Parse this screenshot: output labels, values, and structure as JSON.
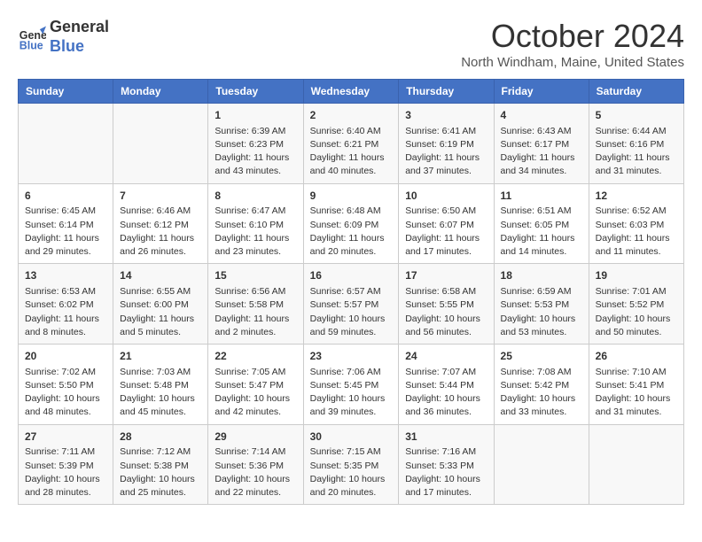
{
  "header": {
    "logo_line1": "General",
    "logo_line2": "Blue",
    "month": "October 2024",
    "location": "North Windham, Maine, United States"
  },
  "days_of_week": [
    "Sunday",
    "Monday",
    "Tuesday",
    "Wednesday",
    "Thursday",
    "Friday",
    "Saturday"
  ],
  "weeks": [
    [
      {
        "day": "",
        "info": ""
      },
      {
        "day": "",
        "info": ""
      },
      {
        "day": "1",
        "info": "Sunrise: 6:39 AM\nSunset: 6:23 PM\nDaylight: 11 hours and 43 minutes."
      },
      {
        "day": "2",
        "info": "Sunrise: 6:40 AM\nSunset: 6:21 PM\nDaylight: 11 hours and 40 minutes."
      },
      {
        "day": "3",
        "info": "Sunrise: 6:41 AM\nSunset: 6:19 PM\nDaylight: 11 hours and 37 minutes."
      },
      {
        "day": "4",
        "info": "Sunrise: 6:43 AM\nSunset: 6:17 PM\nDaylight: 11 hours and 34 minutes."
      },
      {
        "day": "5",
        "info": "Sunrise: 6:44 AM\nSunset: 6:16 PM\nDaylight: 11 hours and 31 minutes."
      }
    ],
    [
      {
        "day": "6",
        "info": "Sunrise: 6:45 AM\nSunset: 6:14 PM\nDaylight: 11 hours and 29 minutes."
      },
      {
        "day": "7",
        "info": "Sunrise: 6:46 AM\nSunset: 6:12 PM\nDaylight: 11 hours and 26 minutes."
      },
      {
        "day": "8",
        "info": "Sunrise: 6:47 AM\nSunset: 6:10 PM\nDaylight: 11 hours and 23 minutes."
      },
      {
        "day": "9",
        "info": "Sunrise: 6:48 AM\nSunset: 6:09 PM\nDaylight: 11 hours and 20 minutes."
      },
      {
        "day": "10",
        "info": "Sunrise: 6:50 AM\nSunset: 6:07 PM\nDaylight: 11 hours and 17 minutes."
      },
      {
        "day": "11",
        "info": "Sunrise: 6:51 AM\nSunset: 6:05 PM\nDaylight: 11 hours and 14 minutes."
      },
      {
        "day": "12",
        "info": "Sunrise: 6:52 AM\nSunset: 6:03 PM\nDaylight: 11 hours and 11 minutes."
      }
    ],
    [
      {
        "day": "13",
        "info": "Sunrise: 6:53 AM\nSunset: 6:02 PM\nDaylight: 11 hours and 8 minutes."
      },
      {
        "day": "14",
        "info": "Sunrise: 6:55 AM\nSunset: 6:00 PM\nDaylight: 11 hours and 5 minutes."
      },
      {
        "day": "15",
        "info": "Sunrise: 6:56 AM\nSunset: 5:58 PM\nDaylight: 11 hours and 2 minutes."
      },
      {
        "day": "16",
        "info": "Sunrise: 6:57 AM\nSunset: 5:57 PM\nDaylight: 10 hours and 59 minutes."
      },
      {
        "day": "17",
        "info": "Sunrise: 6:58 AM\nSunset: 5:55 PM\nDaylight: 10 hours and 56 minutes."
      },
      {
        "day": "18",
        "info": "Sunrise: 6:59 AM\nSunset: 5:53 PM\nDaylight: 10 hours and 53 minutes."
      },
      {
        "day": "19",
        "info": "Sunrise: 7:01 AM\nSunset: 5:52 PM\nDaylight: 10 hours and 50 minutes."
      }
    ],
    [
      {
        "day": "20",
        "info": "Sunrise: 7:02 AM\nSunset: 5:50 PM\nDaylight: 10 hours and 48 minutes."
      },
      {
        "day": "21",
        "info": "Sunrise: 7:03 AM\nSunset: 5:48 PM\nDaylight: 10 hours and 45 minutes."
      },
      {
        "day": "22",
        "info": "Sunrise: 7:05 AM\nSunset: 5:47 PM\nDaylight: 10 hours and 42 minutes."
      },
      {
        "day": "23",
        "info": "Sunrise: 7:06 AM\nSunset: 5:45 PM\nDaylight: 10 hours and 39 minutes."
      },
      {
        "day": "24",
        "info": "Sunrise: 7:07 AM\nSunset: 5:44 PM\nDaylight: 10 hours and 36 minutes."
      },
      {
        "day": "25",
        "info": "Sunrise: 7:08 AM\nSunset: 5:42 PM\nDaylight: 10 hours and 33 minutes."
      },
      {
        "day": "26",
        "info": "Sunrise: 7:10 AM\nSunset: 5:41 PM\nDaylight: 10 hours and 31 minutes."
      }
    ],
    [
      {
        "day": "27",
        "info": "Sunrise: 7:11 AM\nSunset: 5:39 PM\nDaylight: 10 hours and 28 minutes."
      },
      {
        "day": "28",
        "info": "Sunrise: 7:12 AM\nSunset: 5:38 PM\nDaylight: 10 hours and 25 minutes."
      },
      {
        "day": "29",
        "info": "Sunrise: 7:14 AM\nSunset: 5:36 PM\nDaylight: 10 hours and 22 minutes."
      },
      {
        "day": "30",
        "info": "Sunrise: 7:15 AM\nSunset: 5:35 PM\nDaylight: 10 hours and 20 minutes."
      },
      {
        "day": "31",
        "info": "Sunrise: 7:16 AM\nSunset: 5:33 PM\nDaylight: 10 hours and 17 minutes."
      },
      {
        "day": "",
        "info": ""
      },
      {
        "day": "",
        "info": ""
      }
    ]
  ]
}
